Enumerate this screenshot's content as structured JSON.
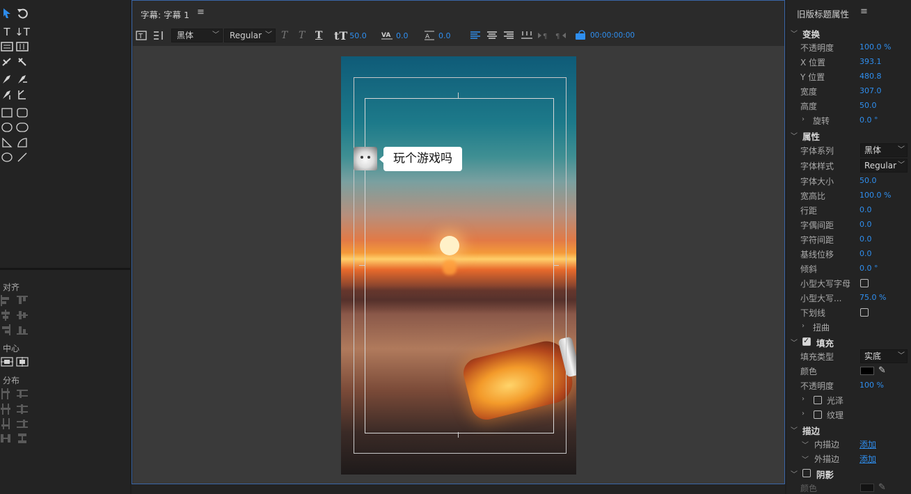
{
  "center": {
    "title": "字幕: 字幕 1",
    "menu": "≡",
    "toolbar": {
      "font_family": "黑体",
      "font_style": "Regular",
      "font_size": "50.0",
      "kerning": "0.0",
      "leading": "0.0",
      "timecode": "00:00:00:00"
    },
    "bubble_text": "玩个游戏吗"
  },
  "tools": {
    "sections": {
      "align": "对齐",
      "center": "中心",
      "distribute": "分布"
    }
  },
  "props": {
    "title": "旧版标题属性",
    "menu": "≡",
    "transform": {
      "header": "变换",
      "rows": [
        {
          "label": "不透明度",
          "value": "100.0 %"
        },
        {
          "label": "X 位置",
          "value": "393.1"
        },
        {
          "label": "Y 位置",
          "value": "480.8"
        },
        {
          "label": "宽度",
          "value": "307.0"
        },
        {
          "label": "高度",
          "value": "50.0"
        }
      ],
      "rotation": {
        "label": "旋转",
        "value": "0.0 °"
      }
    },
    "attributes": {
      "header": "属性",
      "font_family": {
        "label": "字体系列",
        "value": "黑体"
      },
      "font_style": {
        "label": "字体样式",
        "value": "Regular"
      },
      "rows": [
        {
          "label": "字体大小",
          "value": "50.0"
        },
        {
          "label": "宽高比",
          "value": "100.0 %"
        },
        {
          "label": "行距",
          "value": "0.0"
        },
        {
          "label": "字偶间距",
          "value": "0.0"
        },
        {
          "label": "字符间距",
          "value": "0.0"
        },
        {
          "label": "基线位移",
          "value": "0.0"
        },
        {
          "label": "倾斜",
          "value": "0.0 °"
        }
      ],
      "small_caps": {
        "label": "小型大写字母"
      },
      "small_caps_size": {
        "label": "小型大写...",
        "value": "75.0 %"
      },
      "underline": {
        "label": "下划线"
      },
      "distort": {
        "label": "扭曲"
      }
    },
    "fill": {
      "header": "填充",
      "fill_type": {
        "label": "填充类型",
        "value": "实底"
      },
      "color": {
        "label": "颜色",
        "swatch": "#000000"
      },
      "opacity": {
        "label": "不透明度",
        "value": "100 %"
      },
      "sheen": {
        "label": "光泽"
      },
      "texture": {
        "label": "纹理"
      }
    },
    "stroke": {
      "header": "描边",
      "inner": {
        "label": "内描边",
        "action": "添加"
      },
      "outer": {
        "label": "外描边",
        "action": "添加"
      }
    },
    "shadow": {
      "header": "阴影",
      "color": {
        "label": "颜色",
        "swatch": "#000000"
      }
    }
  },
  "colors": {
    "accent": "#2f8ff0",
    "panel": "#232323",
    "canvas": "#3a3a3a"
  }
}
